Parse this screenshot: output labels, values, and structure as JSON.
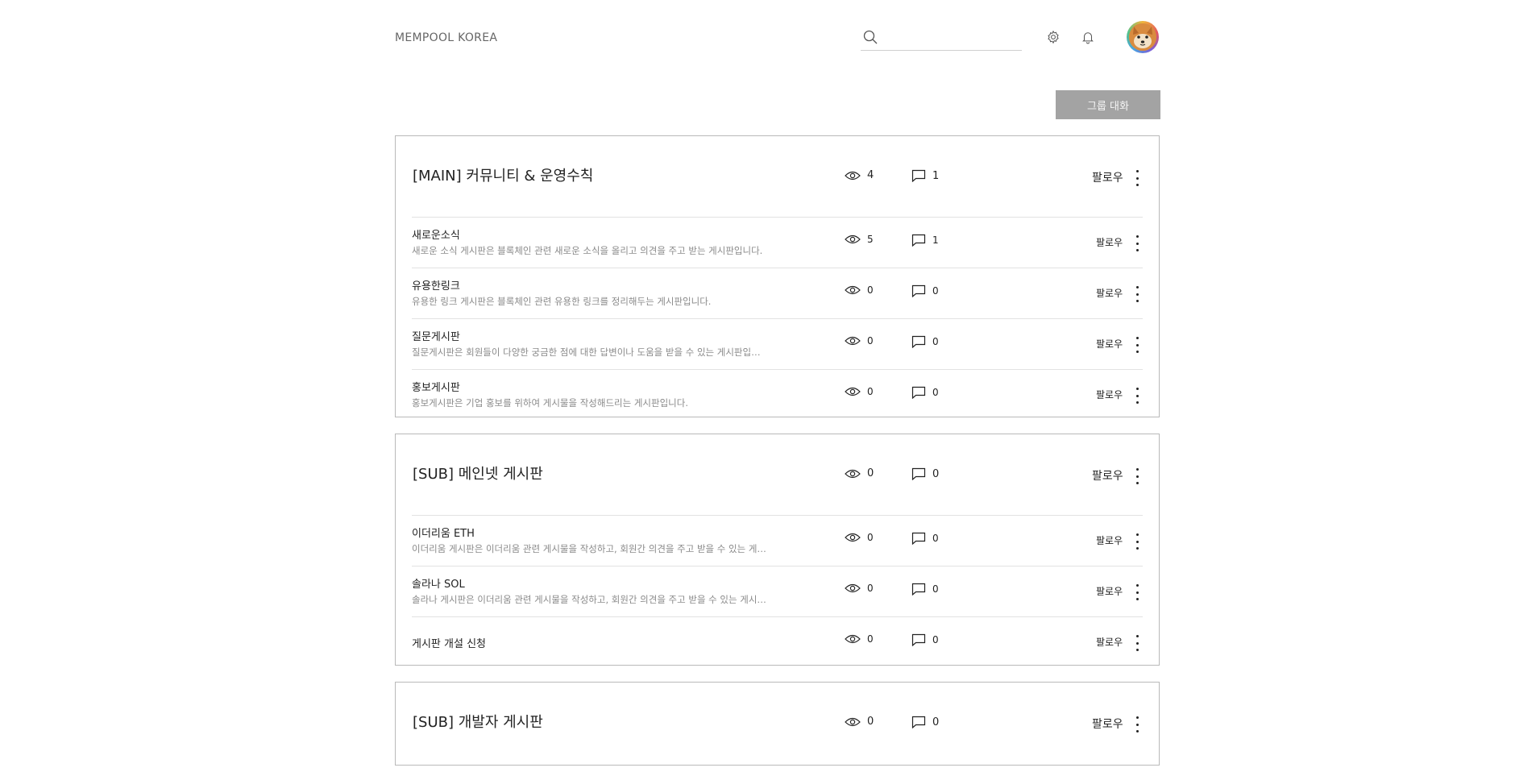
{
  "header": {
    "brand": "MEMPOOL KOREA",
    "search_placeholder": "",
    "icons": {
      "search": "search-icon",
      "settings": "gear-icon",
      "notifications": "bell-icon",
      "avatar": "shiba-avatar"
    }
  },
  "group_chat_label": "그룹 대화",
  "colors": {
    "button_bg": "#a3a3a3",
    "border": "#b9b9b9",
    "divider": "#e2e2e2",
    "muted_text": "#8a8a8a"
  },
  "categories": [
    {
      "title": "[MAIN] 커뮤니티 & 운영수칙",
      "views": "4",
      "comments": "1",
      "follow": "팔로우",
      "boards": [
        {
          "name": "새로운소식",
          "desc": "새로운 소식 게시판은 블록체인 관련 새로운 소식을 올리고 의견을 주고 받는 게시판입니다.",
          "views": "5",
          "comments": "1",
          "follow": "팔로우"
        },
        {
          "name": "유용한링크",
          "desc": "유용한 링크 게시판은 블록체인 관련 유용한 링크를 정리해두는 게시판입니다.",
          "views": "0",
          "comments": "0",
          "follow": "팔로우"
        },
        {
          "name": "질문게시판",
          "desc": "질문게시판은 회원들이 다양한 궁금한 점에 대한 답변이나 도움을 받을 수 있는 게시판입니다.",
          "views": "0",
          "comments": "0",
          "follow": "팔로우"
        },
        {
          "name": "홍보게시판",
          "desc": "홍보게시판은 기업 홍보를 위하여 게시물을 작성해드리는 게시판입니다.",
          "views": "0",
          "comments": "0",
          "follow": "팔로우"
        }
      ]
    },
    {
      "title": "[SUB] 메인넷 게시판",
      "views": "0",
      "comments": "0",
      "follow": "팔로우",
      "boards": [
        {
          "name": "이더리움 ETH",
          "desc": "이더리움 게시판은 이더리움 관련 게시물을 작성하고, 회원간 의견을 주고 받을 수 있는 게시...",
          "views": "0",
          "comments": "0",
          "follow": "팔로우"
        },
        {
          "name": "솔라나 SOL",
          "desc": "솔라나 게시판은 이더리움 관련 게시물을 작성하고, 회원간 의견을 주고 받을 수 있는 게시판...",
          "views": "0",
          "comments": "0",
          "follow": "팔로우"
        },
        {
          "name": "게시판 개설 신청",
          "desc": "",
          "views": "0",
          "comments": "0",
          "follow": "팔로우"
        }
      ]
    },
    {
      "title": "[SUB] 개발자 게시판",
      "views": "0",
      "comments": "0",
      "follow": "팔로우",
      "boards": []
    }
  ]
}
